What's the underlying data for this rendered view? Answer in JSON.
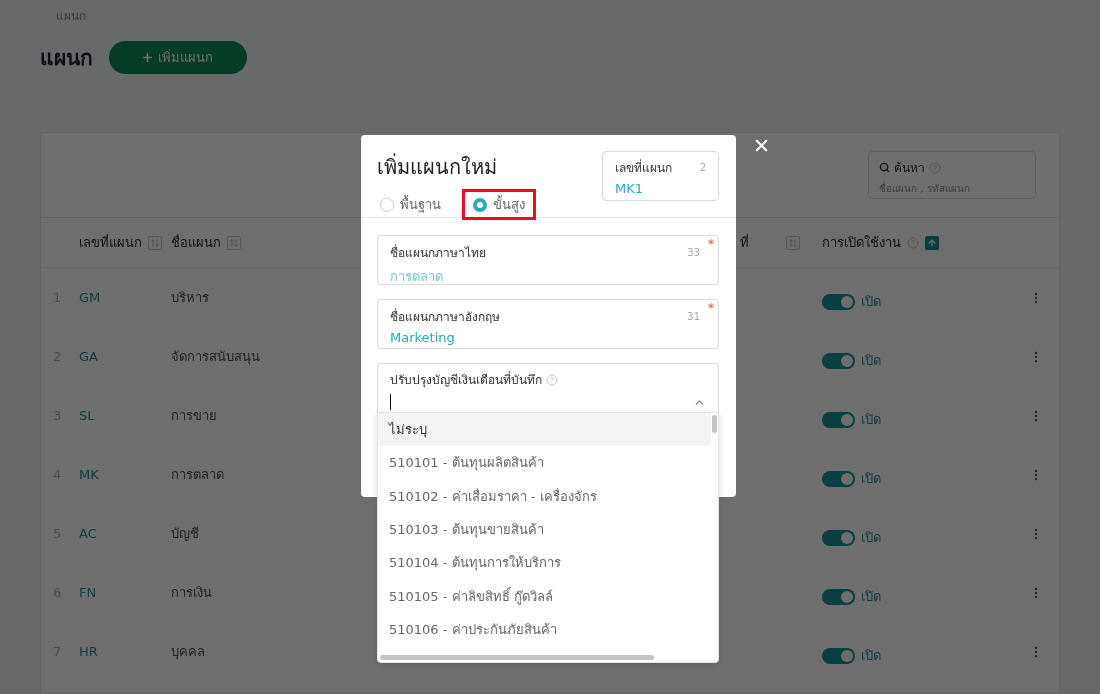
{
  "breadcrumb": "แผนก",
  "header": {
    "title": "แผนก",
    "add_button": "เพิ่มแผนก"
  },
  "search": {
    "label": "ค้นหา",
    "placeholder": "ชื่อแผนก , รหัสแผนก"
  },
  "table": {
    "columns": [
      {
        "label": "เลขที่แผนก",
        "sort_active": false
      },
      {
        "label": "ชื่อแผนก",
        "sort_active": false
      },
      {
        "label": "ที่",
        "sort_active": false
      },
      {
        "label": "การเปิดใช้งาน",
        "sort_active": true
      }
    ],
    "rows": [
      {
        "index": "1",
        "code": "GM",
        "name": "บริหาร",
        "status": "เปิด",
        "on": true
      },
      {
        "index": "2",
        "code": "GA",
        "name": "จัดการสนับสนุน",
        "status": "เปิด",
        "on": true
      },
      {
        "index": "3",
        "code": "SL",
        "name": "การขาย",
        "status": "เปิด",
        "on": true
      },
      {
        "index": "4",
        "code": "MK",
        "name": "การตลาด",
        "status": "เปิด",
        "on": true
      },
      {
        "index": "5",
        "code": "AC",
        "name": "บัญชี",
        "status": "เปิด",
        "on": true
      },
      {
        "index": "6",
        "code": "FN",
        "name": "การเงิน",
        "status": "เปิด",
        "on": true
      },
      {
        "index": "7",
        "code": "HR",
        "name": "บุคคล",
        "status": "เปิด",
        "on": true
      }
    ]
  },
  "modal": {
    "title": "เพิ่มแผนกใหม่",
    "modes": [
      {
        "label": "พื้นฐาน",
        "selected": false,
        "highlighted": false
      },
      {
        "label": "ขั้นสูง",
        "selected": true,
        "highlighted": true
      }
    ],
    "code_field": {
      "label": "เลขที่แผนก",
      "counter": "2",
      "value": "MK1"
    },
    "fields": [
      {
        "label": "ชื่อแผนกภาษาไทย",
        "counter": "33",
        "required": true,
        "required_mark": "*",
        "value": "การตลาด"
      },
      {
        "label": "ชื่อแผนกภาษาอังกฤษ",
        "counter": "31",
        "required": true,
        "required_mark": "*",
        "value": "Marketing"
      }
    ],
    "select": {
      "label": "ปรับปรุงบัญชีเงินเดือนที่บันทึก",
      "expanded": true,
      "options": [
        {
          "label": "ไม่ระบุ",
          "selected": true
        },
        {
          "label": "510101 - ต้นทุนผลิตสินค้า",
          "selected": false
        },
        {
          "label": "510102 - ค่าเสื่อมราคา - เครื่องจักร",
          "selected": false
        },
        {
          "label": "510103 - ต้นทุนขายสินค้า",
          "selected": false
        },
        {
          "label": "510104 - ต้นทุนการให้บริการ",
          "selected": false
        },
        {
          "label": "510105 - ค่าลิขสิทธิ์ กู๊ดวิลล์",
          "selected": false
        },
        {
          "label": "510106 - ค่าประกันภัยสินค้า",
          "selected": false
        }
      ]
    }
  }
}
